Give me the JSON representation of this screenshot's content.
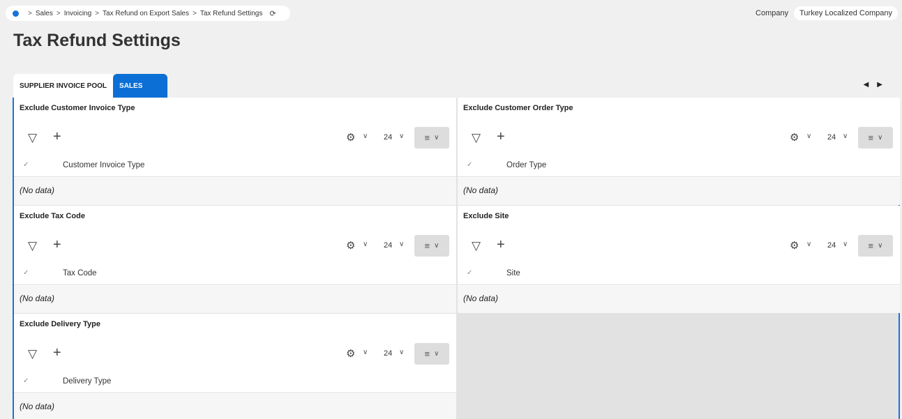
{
  "breadcrumb": {
    "items": [
      "Sales",
      "Invoicing",
      "Tax Refund on Export Sales",
      "Tax Refund Settings"
    ],
    "separator": ">"
  },
  "company": {
    "label": "Company",
    "value": "Turkey Localized Company"
  },
  "page": {
    "title": "Tax Refund Settings"
  },
  "tabs": [
    {
      "label": "SUPPLIER INVOICE POOL",
      "active": false
    },
    {
      "label": "SALES",
      "active": true
    }
  ],
  "panels": [
    {
      "title": "Exclude Customer Invoice Type",
      "column": "Customer Invoice Type",
      "page_size": "24",
      "empty_text": "(No data)"
    },
    {
      "title": "Exclude Customer Order Type",
      "column": "Order Type",
      "page_size": "24",
      "empty_text": "(No data)"
    },
    {
      "title": "Exclude Tax Code",
      "column": "Tax Code",
      "page_size": "24",
      "empty_text": "(No data)"
    },
    {
      "title": "Exclude Site",
      "column": "Site",
      "page_size": "24",
      "empty_text": "(No data)"
    },
    {
      "title": "Exclude Delivery Type",
      "column": "Delivery Type",
      "page_size": "24",
      "empty_text": "(No data)"
    }
  ],
  "icons": {
    "filter": "filter-icon",
    "add": "plus-icon",
    "settings": "gear-icon",
    "view": "list-view-icon",
    "refresh": "refresh-icon",
    "nav_prev": "caret-left-icon",
    "nav_next": "caret-right-icon"
  },
  "colors": {
    "accent": "#0b6fd6",
    "home_dot": "#1a73d9"
  }
}
